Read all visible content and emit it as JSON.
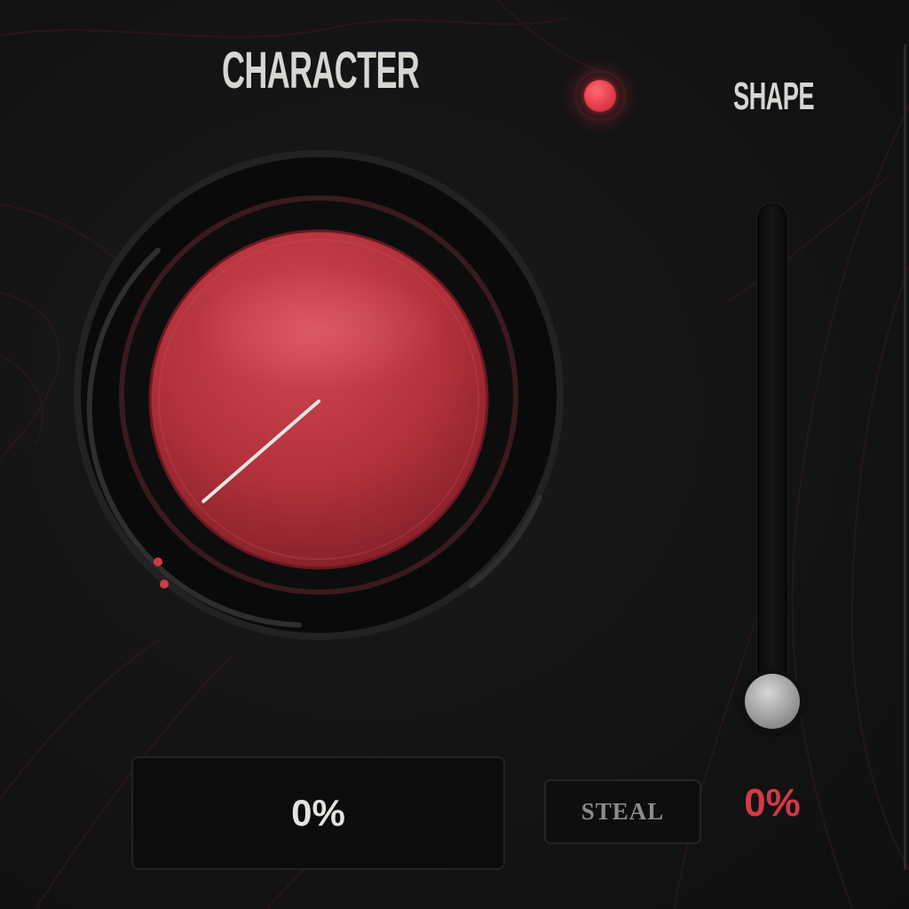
{
  "plugin": {
    "character_title": "CHARACTER",
    "shape_title": "SHAPE",
    "character_value": "0%",
    "shape_value": "0%",
    "steal_label": "STEAL",
    "power_on": true
  },
  "controls": {
    "character_knob": {
      "level": 0.0
    },
    "shape_slider": {
      "level": 0.0
    }
  },
  "colors": {
    "accent": "#d23a45",
    "knob_red": "#c23a44",
    "label": "#d6d6d2",
    "background": "#141415"
  },
  "icons": {
    "power": "power-led-icon"
  }
}
